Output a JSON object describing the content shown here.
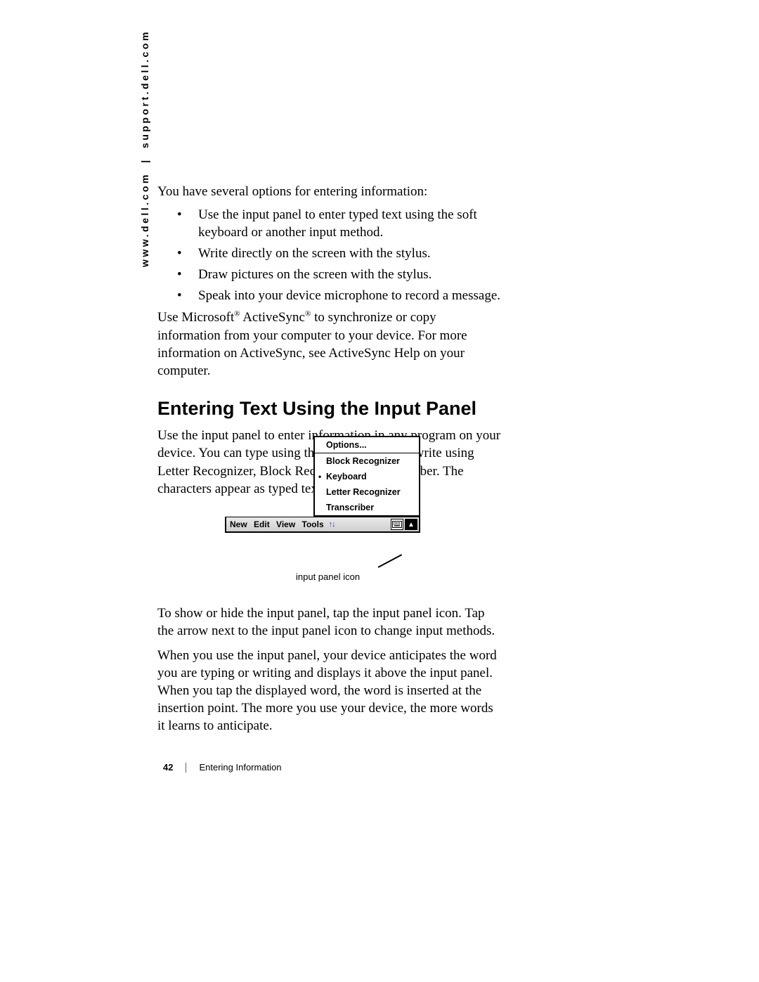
{
  "side_url": {
    "left": "www.dell.com",
    "right": "support.dell.com"
  },
  "intro": "You have several options for entering information:",
  "bullets": [
    "Use the input panel to enter typed text using the soft keyboard or another input method.",
    "Write directly on the screen with the stylus.",
    "Draw pictures on the screen with the stylus.",
    "Speak into your device microphone to record a message."
  ],
  "sync_para_parts": {
    "a": "Use Microsoft",
    "b": " ActiveSync",
    "c": " to synchronize or copy information from your computer to your device. For more information on ActiveSync, see ActiveSync Help on your computer."
  },
  "heading": "Entering Text Using the Input Panel",
  "heading_para": "Use the input panel to enter information in any program on your device. You can type using the soft keyboard or write using Letter Recognizer, Block Recognizer, or Transcriber. The characters appear as typed text on the screen.",
  "figure": {
    "menu": {
      "options": "Options...",
      "items": [
        "Block Recognizer",
        "Keyboard",
        "Letter Recognizer",
        "Transcriber"
      ],
      "selected_index": 1
    },
    "taskbar": {
      "menus": [
        "New",
        "Edit",
        "View",
        "Tools"
      ]
    },
    "callout": "input panel icon"
  },
  "lower_para_1": "To show or hide the input panel, tap the input panel icon. Tap the arrow next to the input panel icon to change input methods.",
  "lower_para_2": "When you use the input panel, your device anticipates the word you are typing or writing and displays it above the input panel. When you tap the displayed word, the word is inserted at the insertion point. The more you use your device, the more words it learns to anticipate.",
  "footer": {
    "page": "42",
    "section": "Entering Information"
  }
}
